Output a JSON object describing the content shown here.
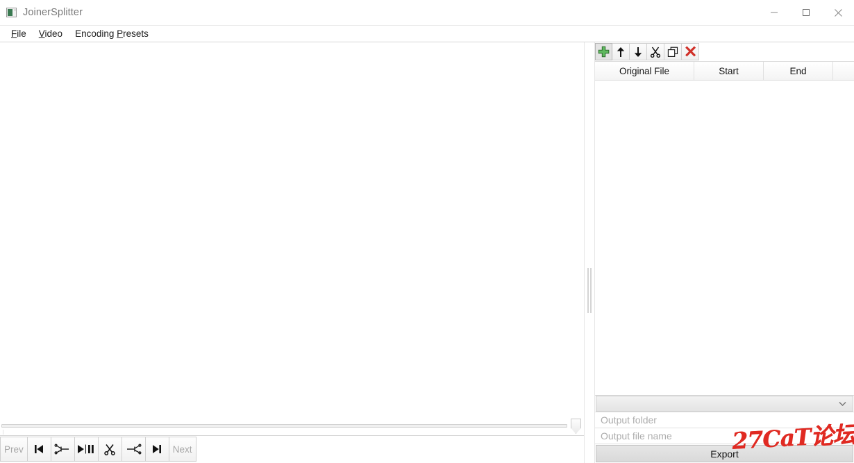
{
  "window": {
    "title": "JoinerSplitter",
    "app_icon": "app-window-icon",
    "controls": {
      "minimize": "minimize-icon",
      "maximize": "maximize-icon",
      "close": "close-icon"
    }
  },
  "menubar": {
    "items": [
      {
        "pre": "",
        "mnemonic": "F",
        "post": "ile"
      },
      {
        "pre": "",
        "mnemonic": "V",
        "post": "ideo"
      },
      {
        "pre": "Encoding ",
        "mnemonic": "P",
        "post": "resets"
      }
    ]
  },
  "transport": {
    "prev_label": "Prev",
    "next_label": "Next",
    "buttons": [
      "prev-button",
      "skip-to-start-button",
      "set-start-marker-button",
      "play-pause-button",
      "cut-button",
      "set-end-marker-button",
      "skip-to-end-button",
      "next-button"
    ]
  },
  "seek": {
    "name": "video-seek-slider",
    "position_percent": 100
  },
  "list_toolbar": {
    "buttons": [
      {
        "name": "add-file-button",
        "icon": "plus-icon",
        "selected": true
      },
      {
        "name": "move-up-button",
        "icon": "arrow-up-icon",
        "selected": false
      },
      {
        "name": "move-down-button",
        "icon": "arrow-down-icon",
        "selected": false
      },
      {
        "name": "cut-segment-button",
        "icon": "scissors-icon",
        "selected": false
      },
      {
        "name": "duplicate-button",
        "icon": "copy-icon",
        "selected": false
      },
      {
        "name": "remove-button",
        "icon": "delete-x-icon",
        "selected": false
      }
    ]
  },
  "file_table": {
    "columns": [
      "Original File",
      "Start",
      "End"
    ],
    "rows": []
  },
  "preset_combo": {
    "value": "",
    "chevron": "chevron-down-icon"
  },
  "output": {
    "folder_placeholder": "Output folder",
    "folder_value": "",
    "filename_placeholder": "Output file name",
    "filename_value": ""
  },
  "export": {
    "label": "Export"
  },
  "watermark": {
    "text": "27CaT论坛",
    "color": "#e02a22"
  }
}
